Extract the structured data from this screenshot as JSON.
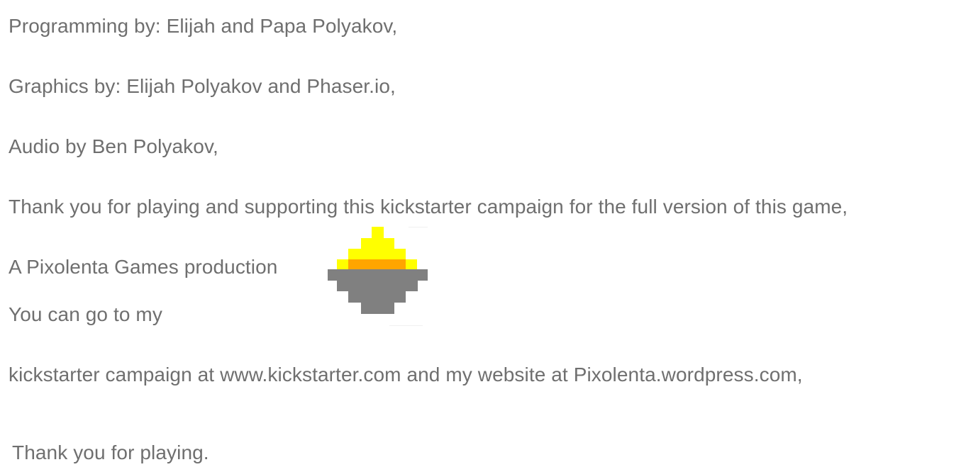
{
  "credits": {
    "programming": "Programming by: Elijah and Papa Polyakov,",
    "graphics": "Graphics by: Elijah Polyakov and Phaser.io,",
    "audio": "Audio by Ben Polyakov,",
    "thanks_support": "Thank you for playing and supporting this kickstarter campaign for the full version of this game,",
    "production": "A Pixolenta Games production",
    "go_to": "You can go to my",
    "links_line": "kickstarter campaign at www.kickstarter.com and my website at Pixolenta.wordpress.com,",
    "final_thanks": "Thank you for playing."
  },
  "logo": {
    "icon": "pixel-brazier-logo",
    "colors": {
      "flame_top": "#ffff00",
      "flame_base": "#ffa500",
      "bowl": "#808080",
      "text": "#6f6f6f"
    }
  }
}
